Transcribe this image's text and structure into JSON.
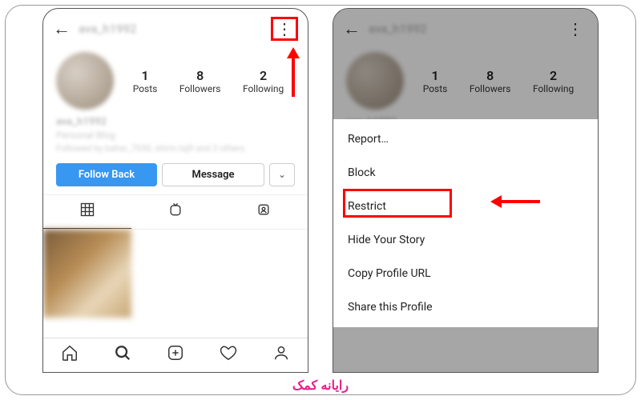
{
  "profile": {
    "username_blurred": "ava_h1992",
    "stats": {
      "posts": {
        "count": "1",
        "label": "Posts"
      },
      "followers": {
        "count": "8",
        "label": "Followers"
      },
      "following": {
        "count": "2",
        "label": "Following"
      }
    },
    "bio_name_blurred": "ava_h1992",
    "bio_type_blurred": "Personal Blog",
    "bio_followed_blurred": "Followed by bahar_7030, shirin.taj9 and 3 others",
    "buttons": {
      "follow": "Follow Back",
      "message": "Message",
      "dropdown": "⌄"
    }
  },
  "menu": {
    "items": [
      "Report…",
      "Block",
      "Restrict",
      "Hide Your Story",
      "Copy Profile URL",
      "Share this Profile"
    ]
  },
  "bottom_nav": {
    "home": "home-icon",
    "search": "search-icon",
    "add": "add-post-icon",
    "activity": "heart-icon",
    "profile": "profile-icon"
  },
  "annotations": {
    "highlight_color": "#ff0000"
  },
  "watermark": "رایانه کمک"
}
